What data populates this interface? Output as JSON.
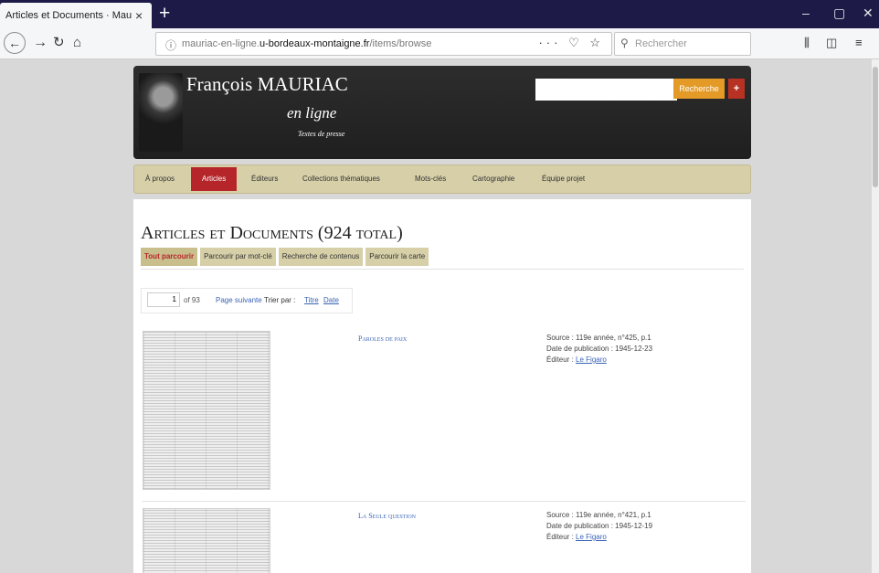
{
  "browser": {
    "tab_title": "Articles et Documents · Mauriac en",
    "tab_close": "×",
    "new_tab": "+",
    "url_prefix": "mauriac-en-ligne.",
    "url_domain": "u-bordeaux-montaigne.fr",
    "url_path": "/items/browse",
    "url_actions": "··· ♡ ☆",
    "search_placeholder": "Rechercher",
    "win_minimize": "–",
    "win_restore": "▢",
    "win_close": "✕"
  },
  "site": {
    "title": "François MAURIAC",
    "subtitle": "en ligne",
    "tagline": "Textes de presse",
    "search_button": "Recherche",
    "advanced_button": "+"
  },
  "menu": [
    {
      "label": "À propos"
    },
    {
      "label": "Articles",
      "active": true
    },
    {
      "label": "Éditeurs"
    },
    {
      "label": "Collections thématiques"
    },
    {
      "label": "Mots-clés"
    },
    {
      "label": "Cartographie"
    },
    {
      "label": "Équipe projet"
    }
  ],
  "page": {
    "title": "Articles et Documents (924 total)",
    "subnav": [
      "Tout parcourir",
      "Parcourir par mot-clé",
      "Recherche de contenus",
      "Parcourir la carte"
    ],
    "pager": {
      "current": "1",
      "of": "of 93",
      "next": "Page suivante",
      "sort_label": "Trier par :",
      "sort_title": "Titre",
      "sort_date": "Date"
    }
  },
  "items": [
    {
      "title": "Paroles de paix",
      "source": "Source : 119e année, n°425, p.1",
      "date": "Date de publication : 1945-12-23",
      "editor_label": "Éditeur :",
      "editor": "Le Figaro"
    },
    {
      "title": "La Seule question",
      "source": "Source : 119e année, n°421, p.1",
      "date": "Date de publication : 1945-12-19",
      "editor_label": "Éditeur :",
      "editor": "Le Figaro"
    }
  ]
}
